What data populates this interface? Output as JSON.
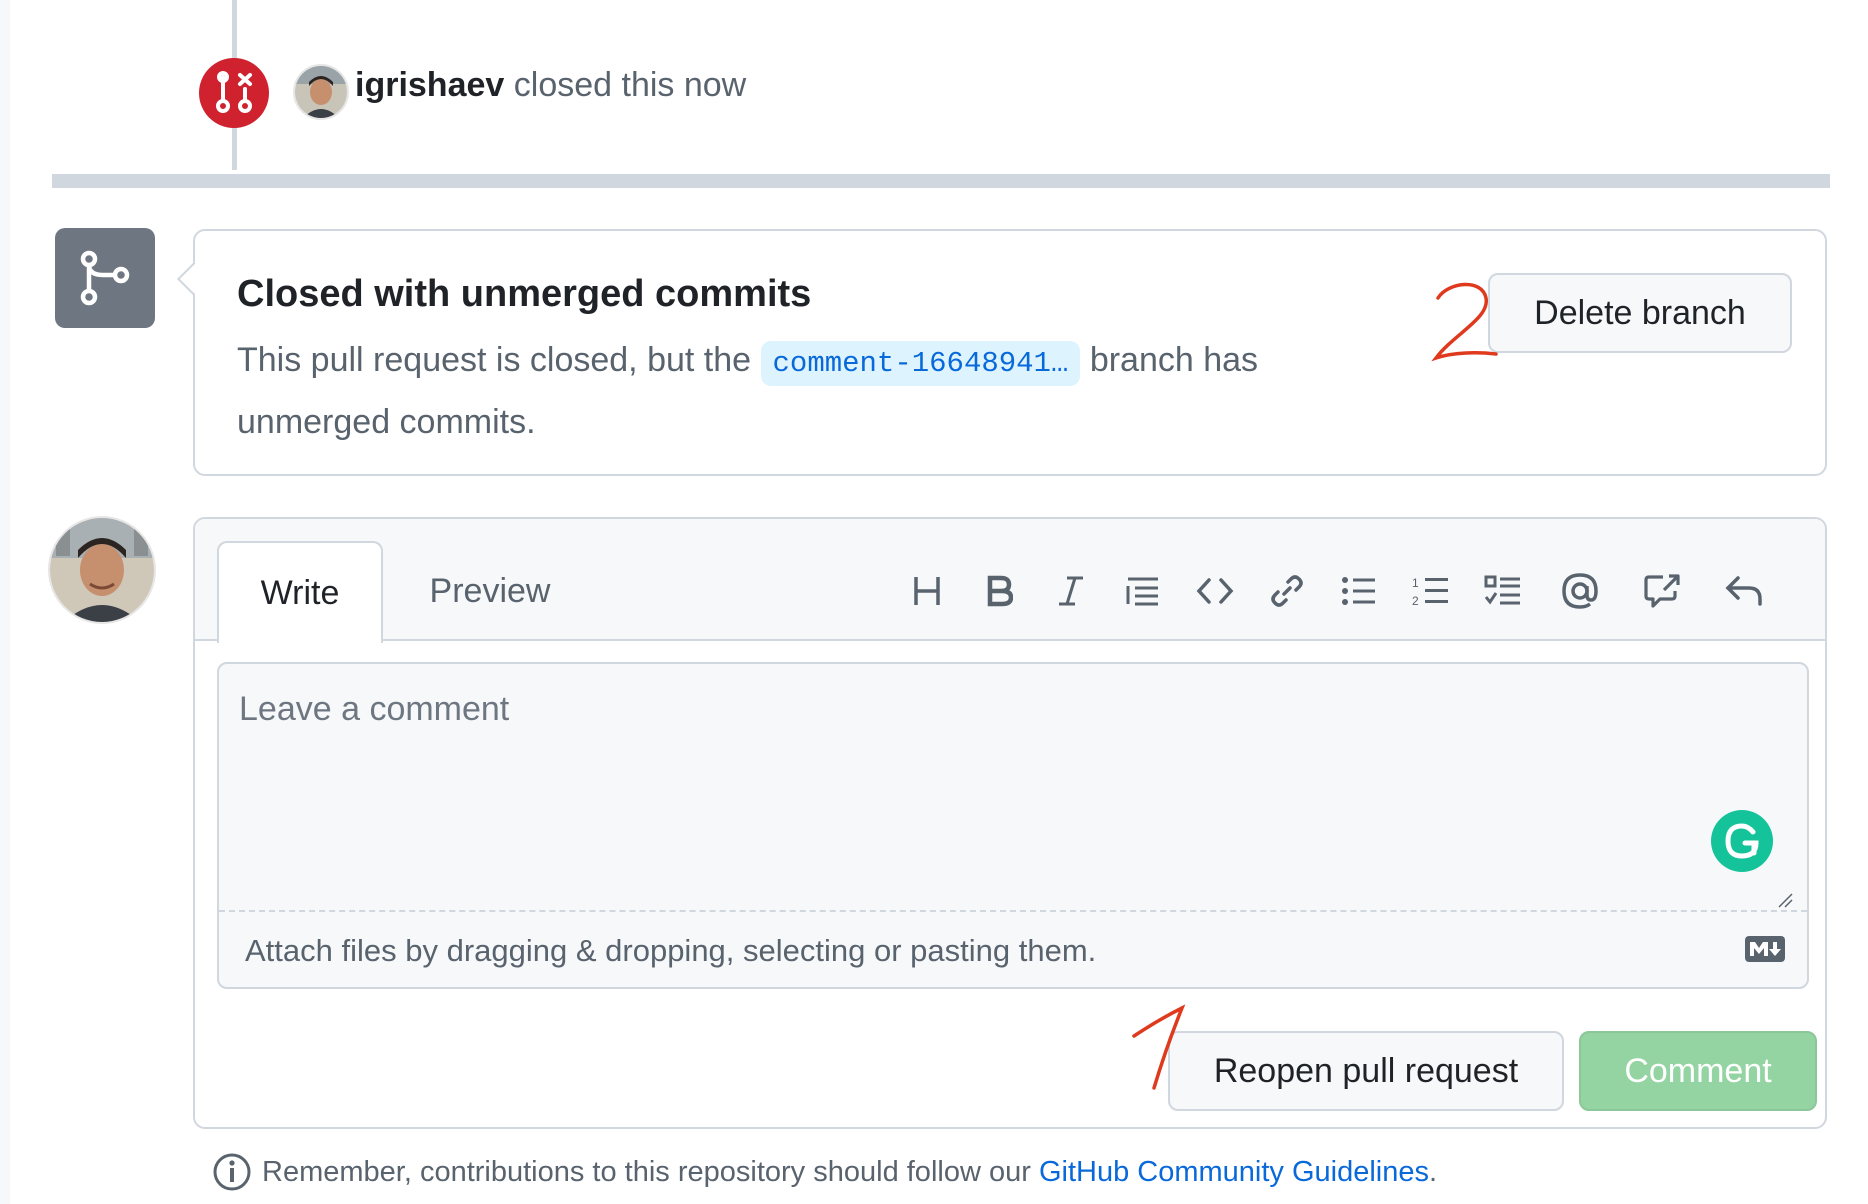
{
  "timeline": {
    "author": "igrishaev",
    "action": "closed this now"
  },
  "merge_status": {
    "title": "Closed with unmerged commits",
    "desc_before": "This pull request is closed, but the",
    "branch_name": "comment-16648941…",
    "desc_after": "branch has unmerged commits.",
    "delete_button": "Delete branch"
  },
  "comment_form": {
    "tabs": [
      {
        "label": "Write",
        "active": true
      },
      {
        "label": "Preview",
        "active": false
      }
    ],
    "toolbar_icons": [
      "heading-icon",
      "bold-icon",
      "italic-icon",
      "quote-icon",
      "code-icon",
      "link-icon",
      "bulleted-list-icon",
      "numbered-list-icon",
      "task-list-icon",
      "mention-icon",
      "cross-reference-icon",
      "reply-icon"
    ],
    "placeholder": "Leave a comment",
    "attach_text": "Attach files by dragging & dropping, selecting or pasting them.",
    "reopen_button": "Reopen pull request",
    "comment_button": "Comment"
  },
  "guideline": {
    "text": "Remember, contributions to this repository should follow our",
    "link": "GitHub Community Guidelines",
    "end": "."
  },
  "annotations": {
    "one": "1",
    "two": "2"
  },
  "colors": {
    "closed": "#cf222e",
    "branch_badge": "#6e7781",
    "comment_disabled": "#94d3a2",
    "annotation": "#e03a1e",
    "link": "#0969da"
  }
}
